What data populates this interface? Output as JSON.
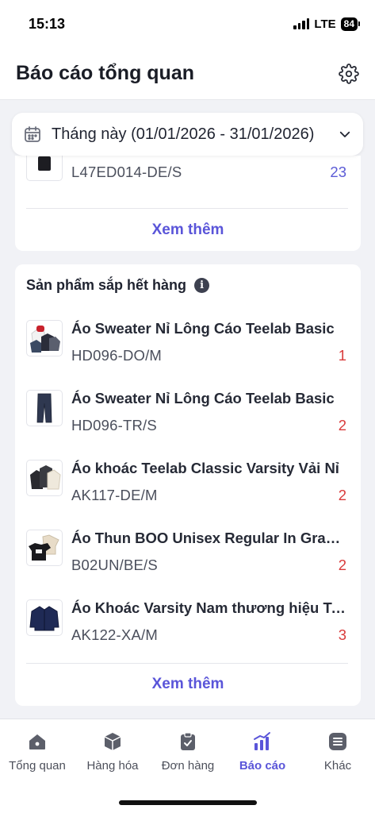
{
  "status_bar": {
    "time": "15:13",
    "network": "LTE",
    "battery": "84"
  },
  "header": {
    "title": "Báo cáo tổng quan"
  },
  "date_filter": {
    "label": "Tháng này (01/01/2026 - 31/01/2026)"
  },
  "top_card": {
    "item": {
      "sku": "L47ED014-DE/S",
      "qty": "23"
    },
    "see_more": "Xem thêm"
  },
  "low_stock": {
    "title": "Sản phẩm sắp hết hàng",
    "items": [
      {
        "name": "Áo Sweater Nỉ Lông Cáo Teelab Basic",
        "sku": "HD096-DO/M",
        "qty": "1"
      },
      {
        "name": "Áo Sweater Nỉ Lông Cáo Teelab Basic",
        "sku": "HD096-TR/S",
        "qty": "2"
      },
      {
        "name": "Áo khoác Teelab Classic Varsity Vải Nỉ",
        "sku": "AK117-DE/M",
        "qty": "2"
      },
      {
        "name": "Áo Thun BOO Unisex Regular In Graphic",
        "sku": "B02UN/BE/S",
        "qty": "2"
      },
      {
        "name": "Áo Khoác Varsity Nam thương hiệu Teelab",
        "sku": "AK122-XA/M",
        "qty": "3"
      }
    ],
    "see_more": "Xem thêm"
  },
  "bottom_nav": [
    {
      "label": "Tổng quan",
      "icon": "home-icon"
    },
    {
      "label": "Hàng hóa",
      "icon": "box-icon"
    },
    {
      "label": "Đơn hàng",
      "icon": "clipboard-icon"
    },
    {
      "label": "Báo cáo",
      "icon": "chart-icon",
      "active": true
    },
    {
      "label": "Khác",
      "icon": "menu-icon"
    }
  ],
  "colors": {
    "accent": "#5a55d9",
    "low_qty": "#d93a3a",
    "background": "#f1f2f6"
  }
}
